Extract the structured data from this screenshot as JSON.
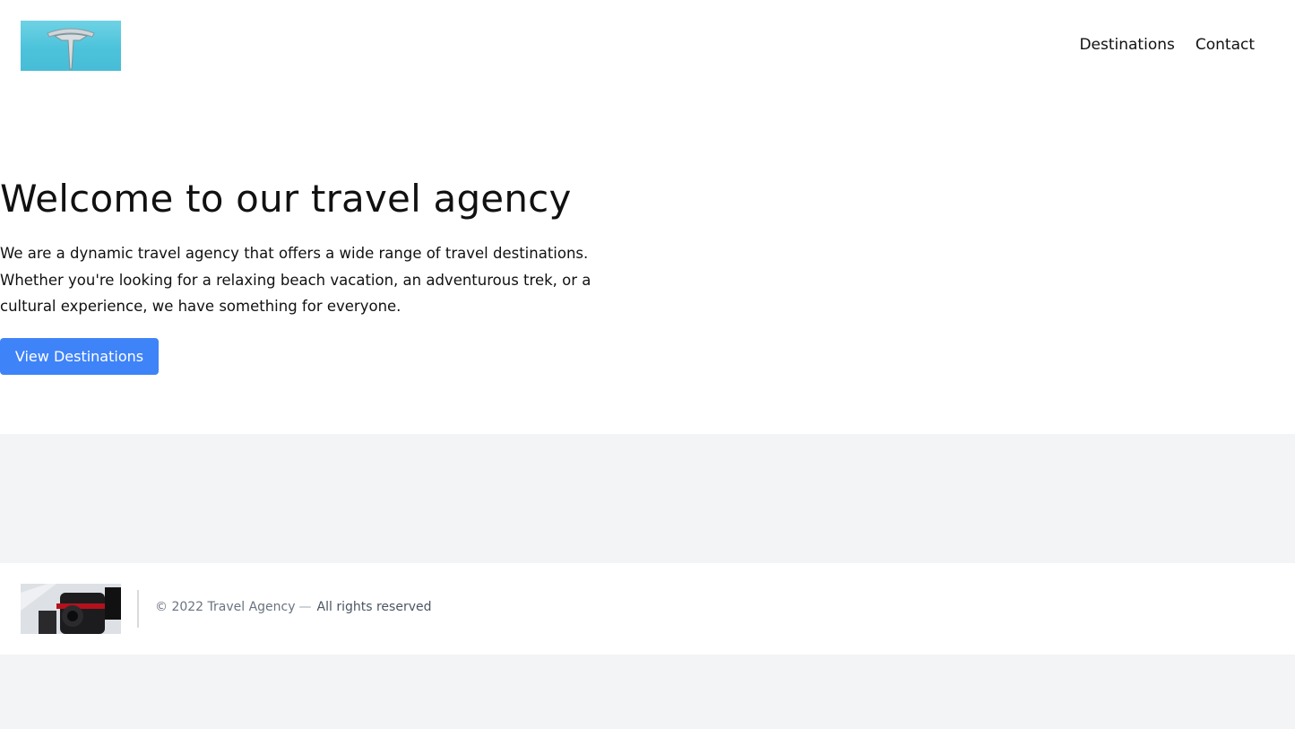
{
  "header": {
    "logo_icon": "tesla-logo-icon",
    "nav": [
      {
        "label": "Destinations"
      },
      {
        "label": "Contact"
      }
    ]
  },
  "hero": {
    "title": "Welcome to our travel agency",
    "description": "We are a dynamic travel agency that offers a wide range of travel destinations. Whether you're looking for a relaxing beach vacation, an adventurous trek, or a cultural experience, we have something for everyone.",
    "button_label": "View Destinations",
    "button_color": "#3f83f8"
  },
  "footer": {
    "image_icon": "camera-lens-photo",
    "copyright": "© 2022 Travel Agency",
    "separator": "—",
    "rights": "All rights reserved"
  },
  "colors": {
    "page_background": "#f3f4f6",
    "surface": "#ffffff",
    "accent": "#3f83f8"
  }
}
